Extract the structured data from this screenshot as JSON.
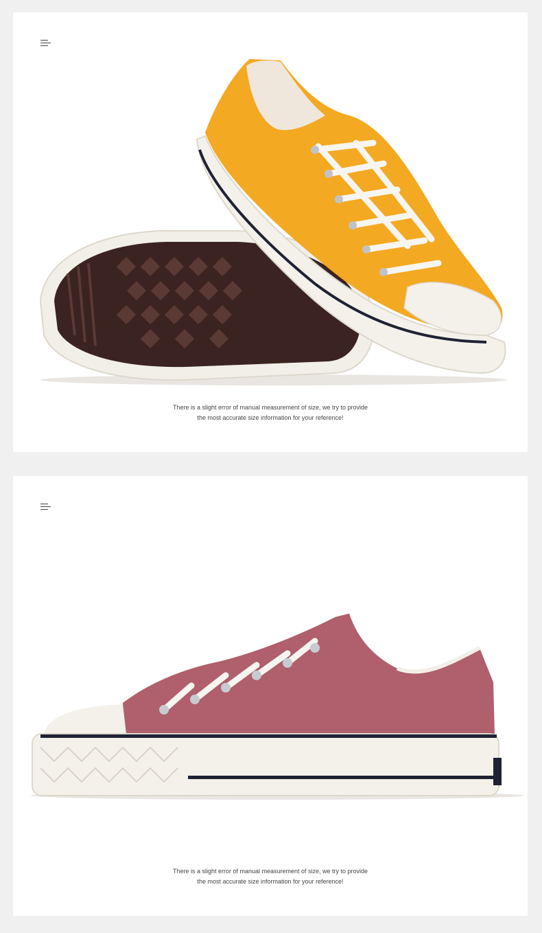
{
  "cards": [
    {
      "caption_line1": "There is a slight error of manual measurement of size, we try to provide",
      "caption_line2": "the most accurate size information for your reference!",
      "product_color": "#f4a922"
    },
    {
      "caption_line1": "There is a slight error of manual measurement of size, we try to provide",
      "caption_line2": "the most accurate size information for your reference!",
      "product_color": "#b05f6c"
    }
  ],
  "colors": {
    "page_background": "#f0f0f0",
    "card_background": "#ffffff",
    "sole_white": "#f2efe8",
    "outsole_dark": "#3a2320",
    "stripe": "#1f2233"
  }
}
